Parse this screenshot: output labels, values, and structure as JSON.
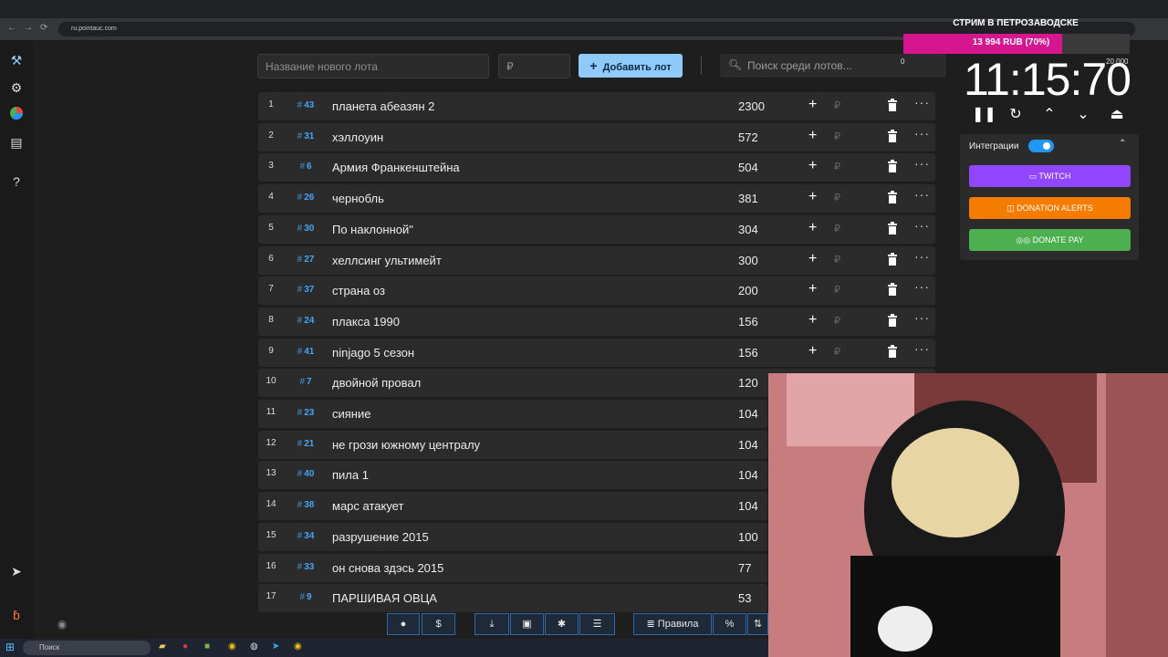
{
  "browser": {
    "url": "ru.pointauc.com"
  },
  "controls": {
    "new_lot_placeholder": "Название нового лота",
    "amount_placeholder": "₽",
    "add_button": "Добавить лот",
    "search_placeholder": "Поиск среди лотов..."
  },
  "lots": [
    {
      "index": "1",
      "id": "43",
      "name": "планета абеазян 2",
      "amount": "2300"
    },
    {
      "index": "2",
      "id": "31",
      "name": "хэллоуин",
      "amount": "572"
    },
    {
      "index": "3",
      "id": "6",
      "name": "Армия Франкенштейна",
      "amount": "504"
    },
    {
      "index": "4",
      "id": "26",
      "name": "чернобль",
      "amount": "381"
    },
    {
      "index": "5",
      "id": "30",
      "name": "По наклонной\"",
      "amount": "304"
    },
    {
      "index": "6",
      "id": "27",
      "name": "хеллсинг ультимейт",
      "amount": "300"
    },
    {
      "index": "7",
      "id": "37",
      "name": "страна оз",
      "amount": "200"
    },
    {
      "index": "8",
      "id": "24",
      "name": "плакса 1990",
      "amount": "156"
    },
    {
      "index": "9",
      "id": "41",
      "name": "ninjago 5 сезон",
      "amount": "156"
    },
    {
      "index": "10",
      "id": "7",
      "name": " двойной провал",
      "amount": "120"
    },
    {
      "index": "11",
      "id": "23",
      "name": "сияние",
      "amount": "104"
    },
    {
      "index": "12",
      "id": "21",
      "name": "не грози южному централу",
      "amount": "104"
    },
    {
      "index": "13",
      "id": "40",
      "name": "пила 1",
      "amount": "104"
    },
    {
      "index": "14",
      "id": "38",
      "name": "марс атакует",
      "amount": "104"
    },
    {
      "index": "15",
      "id": "34",
      "name": "разрушение 2015",
      "amount": "100"
    },
    {
      "index": "16",
      "id": "33",
      "name": "он снова здэсь 2015",
      "amount": "77"
    },
    {
      "index": "17",
      "id": "9",
      "name": "ПАРШИВАЯ ОВЦА",
      "amount": "53"
    }
  ],
  "row_symbols": {
    "hash": "#",
    "plus": "+",
    "rub": "₽",
    "more": "···"
  },
  "toolbar": {
    "rules_label": "Правила",
    "dollar": "$",
    "percent": "%"
  },
  "overlay": {
    "stream_title": "СТРИМ В ПЕТРОЗАВОДСКЕ",
    "goal_text": "13 994 RUB (70%)",
    "goal_progress": 0.7,
    "goal_min": "0",
    "goal_max": "20 000",
    "timer": "11:15:70"
  },
  "integrations": {
    "label": "Интеграции",
    "enabled": true,
    "buttons": [
      {
        "label": "TWITCH",
        "color": "#9146ff"
      },
      {
        "label": "DONATION ALERTS",
        "color": "#f57c00"
      },
      {
        "label": "DONATE PAY",
        "color": "#4caf50"
      }
    ]
  },
  "taskbar": {
    "search_label": "Поиск"
  },
  "colors": {
    "accent": "#90caf9",
    "lot_id": "#42a5f5",
    "goal_bar": "#d6168f"
  }
}
